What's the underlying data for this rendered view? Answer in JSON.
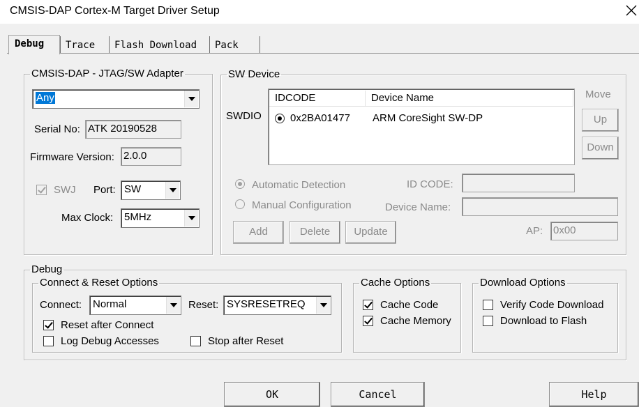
{
  "window": {
    "title": "CMSIS-DAP Cortex-M Target Driver Setup",
    "close_glyph": "✕"
  },
  "tabs": [
    {
      "label": "Debug",
      "active": true
    },
    {
      "label": "Trace",
      "active": false
    },
    {
      "label": "Flash Download",
      "active": false
    },
    {
      "label": "Pack",
      "active": false
    }
  ],
  "adapter": {
    "legend": "CMSIS-DAP - JTAG/SW Adapter",
    "selected": "Any",
    "serial_label": "Serial No:",
    "serial_value": "ATK 20190528",
    "firmware_label": "Firmware Version:",
    "firmware_value": "2.0.0",
    "swj_label": "SWJ",
    "swj_checked": true,
    "port_label": "Port:",
    "port_value": "SW",
    "clock_label": "Max Clock:",
    "clock_value": "5MHz"
  },
  "sw_device": {
    "legend": "SW Device",
    "row_label": "SWDIO",
    "columns": [
      "IDCODE",
      "Device Name"
    ],
    "rows": [
      {
        "idcode": "0x2BA01477",
        "device_name": "ARM CoreSight SW-DP"
      }
    ],
    "move_label": "Move",
    "up_label": "Up",
    "down_label": "Down",
    "auto_detect_label": "Automatic Detection",
    "manual_config_label": "Manual Configuration",
    "idcode_label": "ID CODE:",
    "devname_label": "Device Name:",
    "add_label": "Add",
    "delete_label": "Delete",
    "update_label": "Update",
    "ap_label": "AP:",
    "ap_value": "0x00"
  },
  "debug": {
    "legend": "Debug",
    "connect_reset": {
      "legend": "Connect & Reset Options",
      "connect_label": "Connect:",
      "connect_value": "Normal",
      "reset_label": "Reset:",
      "reset_value": "SYSRESETREQ",
      "reset_after_connect_label": "Reset after Connect",
      "log_debug_label": "Log Debug Accesses",
      "stop_after_reset_label": "Stop after Reset"
    },
    "cache": {
      "legend": "Cache Options",
      "cache_code_label": "Cache Code",
      "cache_memory_label": "Cache Memory"
    },
    "download": {
      "legend": "Download Options",
      "verify_label": "Verify Code Download",
      "flash_label": "Download to Flash"
    }
  },
  "buttons": {
    "ok": "OK",
    "cancel": "Cancel",
    "help": "Help"
  }
}
